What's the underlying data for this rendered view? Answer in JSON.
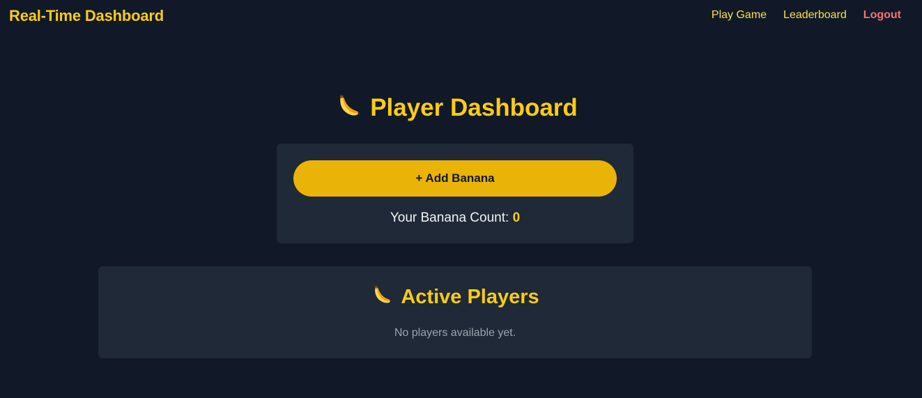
{
  "navbar": {
    "brand": "Real-Time Dashboard",
    "links": [
      {
        "label": "Play Game"
      },
      {
        "label": "Leaderboard"
      },
      {
        "label": "Logout"
      }
    ]
  },
  "page": {
    "title": "Player Dashboard",
    "title_icon": "banana-icon"
  },
  "banana_card": {
    "add_button_label": "+ Add Banana",
    "count_label": "Your Banana Count:",
    "count_value": "0"
  },
  "players": {
    "title": "Active Players",
    "title_icon": "banana-icon",
    "empty_message": "No players available yet."
  },
  "colors": {
    "background": "#111827",
    "card": "#1f2937",
    "accent": "#facc15",
    "button": "#eab308",
    "logout": "#f87171"
  }
}
